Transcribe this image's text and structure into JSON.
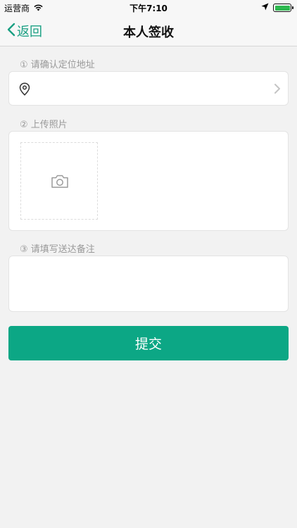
{
  "status_bar": {
    "carrier": "运营商",
    "time": "下午7:10",
    "battery_color": "#2db84f"
  },
  "nav": {
    "back_label": "返回",
    "title": "本人签收"
  },
  "sections": {
    "location_label": "① 请确认定位地址",
    "photo_label": "② 上传照片",
    "note_label": "③ 请填写送达备注"
  },
  "location": {
    "value": ""
  },
  "note": {
    "value": "",
    "placeholder": ""
  },
  "submit_label": "提交",
  "colors": {
    "accent": "#0ca785",
    "back_text": "#1aa083",
    "background": "#f2f2f2"
  },
  "icons": [
    "wifi-icon",
    "location-arrow-icon",
    "battery-icon",
    "back-chevron-icon",
    "map-pin-icon",
    "chevron-right-icon",
    "camera-icon"
  ]
}
